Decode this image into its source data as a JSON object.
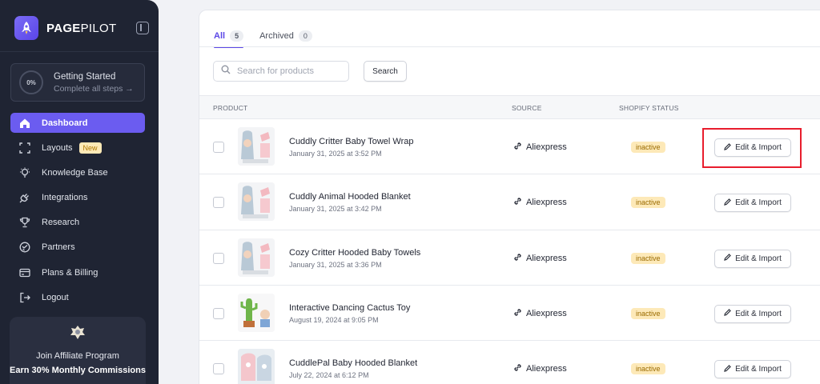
{
  "brand": {
    "name_bold": "PAGE",
    "name_light": "PILOT"
  },
  "getting_started": {
    "percent": "0%",
    "title": "Getting Started",
    "subtitle": "Complete all steps →"
  },
  "nav": {
    "dashboard": "Dashboard",
    "layouts": "Layouts",
    "layouts_badge": "New",
    "knowledge_base": "Knowledge Base",
    "integrations": "Integrations",
    "research": "Research",
    "partners": "Partners",
    "plans_billing": "Plans & Billing",
    "logout": "Logout"
  },
  "affiliate": {
    "title": "Join Affiliate Program",
    "subtitle": "Earn 30% Monthly Commissions"
  },
  "tabs": [
    {
      "label": "All",
      "count": "5"
    },
    {
      "label": "Archived",
      "count": "0"
    }
  ],
  "search": {
    "placeholder": "Search for products",
    "button": "Search"
  },
  "table": {
    "headers": {
      "product": "PRODUCT",
      "source": "SOURCE",
      "status": "SHOPIFY STATUS"
    },
    "rows": [
      {
        "name": "Cuddly Critter Baby Towel Wrap",
        "date": "January 31, 2025 at 3:52 PM",
        "source": "Aliexpress",
        "status": "inactive",
        "action": "Edit & Import",
        "thumb": "towel"
      },
      {
        "name": "Cuddly Animal Hooded Blanket",
        "date": "January 31, 2025 at 3:42 PM",
        "source": "Aliexpress",
        "status": "inactive",
        "action": "Edit & Import",
        "thumb": "towel"
      },
      {
        "name": "Cozy Critter Hooded Baby Towels",
        "date": "January 31, 2025 at 3:36 PM",
        "source": "Aliexpress",
        "status": "inactive",
        "action": "Edit & Import",
        "thumb": "towel"
      },
      {
        "name": "Interactive Dancing Cactus Toy",
        "date": "August 19, 2024 at 9:05 PM",
        "source": "Aliexpress",
        "status": "inactive",
        "action": "Edit & Import",
        "thumb": "cactus"
      },
      {
        "name": "CuddlePal Baby Hooded Blanket",
        "date": "July 22, 2024 at 6:12 PM",
        "source": "Aliexpress",
        "status": "inactive",
        "action": "Edit & Import",
        "thumb": "blanket"
      }
    ]
  },
  "colors": {
    "accent": "#6b5cf0",
    "sidebar_bg": "#1f2433",
    "status_bg": "#fde9b8",
    "highlight": "#e81d2d"
  }
}
